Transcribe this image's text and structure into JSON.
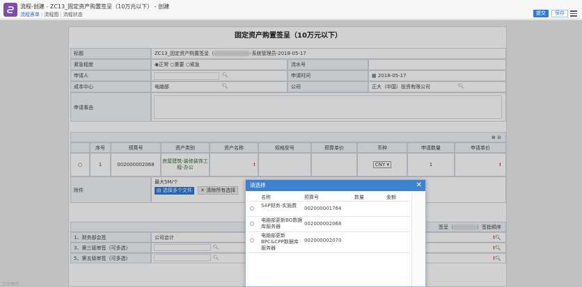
{
  "window": {
    "title": "流程-创建 - ZC13_固定资产购置签呈（10万元以下） - 创建",
    "subnav": [
      "流程表单",
      "流程图",
      "流程状态"
    ]
  },
  "toolbar": {
    "submit_label": "提交",
    "save_label": "保存"
  },
  "form": {
    "title": "固定资产购置签呈（10万元以下）",
    "fields": {
      "subject_label": "标题",
      "subject_prefix": "ZC13_固定资产购置签呈（",
      "subject_suffix": "-系统管理员-2018-05-17",
      "urgency_label": "紧急程度",
      "urgency_options": [
        "正常",
        "重要",
        "紧急"
      ],
      "serial_label": "流水号",
      "applicant_label": "申请人",
      "apply_time_label": "申请时间",
      "apply_time_value": "2018-05-17",
      "cost_center_label": "成本中心",
      "cost_center_value": "电脑部",
      "company_label": "公司",
      "company_value": "正大（中国）投资有限公司",
      "reason_label": "申请事由"
    },
    "grid": {
      "headers": [
        "序号",
        "预算号",
        "资产类别",
        "资产名称",
        "规格型号",
        "预算单价",
        "币种",
        "申请数量",
        "申请单价"
      ],
      "row": {
        "index": "1",
        "budget_no": "002000002068",
        "category": "房屋建筑-装修装饰工程-办公",
        "currency": "CNY",
        "quantity": "1"
      }
    },
    "attachment": {
      "label": "附件",
      "max_size": "最大5M/个",
      "select_btn": "选择多个文件",
      "clear_btn": "清除所有选择"
    },
    "approvals": {
      "side_text_prefix": "签呈（",
      "side_text_suffix": "）签批顺序",
      "rows": [
        {
          "label": "1、财务部会签",
          "value": "公司会计"
        },
        {
          "label": "3、第三级审签（可多选）",
          "value": ""
        },
        {
          "label": "5、第五级审签（可多选）",
          "value": ""
        }
      ]
    }
  },
  "modal": {
    "title": "请选择",
    "columns": [
      "名称",
      "预算号",
      "数量",
      "金额"
    ],
    "rows": [
      {
        "name": "SAP财务-实施费",
        "budget_no": "002000001764"
      },
      {
        "name": "电脑部更新BO数据库服务器",
        "budget_no": "002000002068"
      },
      {
        "name": "电脑部更新BPC&CPP数据库服务器",
        "budget_no": "002000002070"
      }
    ]
  },
  "status_bar": {
    "text": "正在等待 ..."
  }
}
